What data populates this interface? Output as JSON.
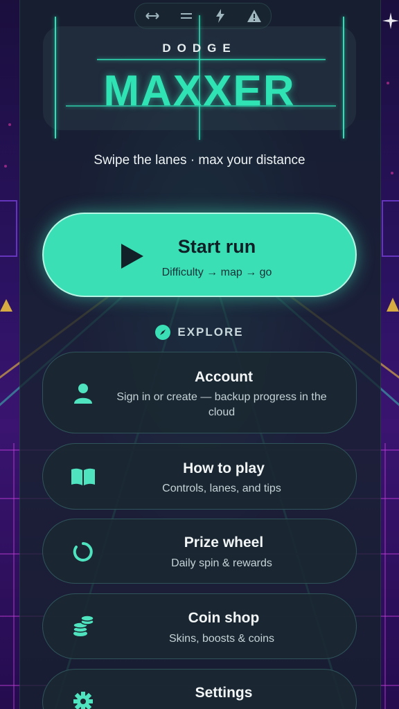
{
  "status_bar": {
    "icons": [
      "swap-horizontal-icon",
      "equals-icon",
      "bolt-icon",
      "warning-icon"
    ]
  },
  "logo": {
    "small": "DODGE",
    "big": "MAXXER"
  },
  "tagline": "Swipe the lanes · max your distance",
  "start_button": {
    "title": "Start run",
    "subtitle": "Difficulty → map → go",
    "icon": "play-icon"
  },
  "explore": {
    "label": "EXPLORE",
    "icon": "compass-icon"
  },
  "menu": [
    {
      "title": "Account",
      "subtitle": "Sign in or create — backup progress in the cloud",
      "icon": "user-icon"
    },
    {
      "title": "How to play",
      "subtitle": "Controls, lanes, and tips",
      "icon": "book-icon"
    },
    {
      "title": "Prize wheel",
      "subtitle": "Daily spin & rewards",
      "icon": "wheel-icon"
    },
    {
      "title": "Coin shop",
      "subtitle": "Skins, boosts & coins",
      "icon": "coins-icon"
    },
    {
      "title": "Settings",
      "subtitle": "",
      "icon": "gear-icon"
    }
  ],
  "colors": {
    "accent": "#3bdfb5",
    "panel": "#16222c",
    "background": "#2a1260"
  }
}
